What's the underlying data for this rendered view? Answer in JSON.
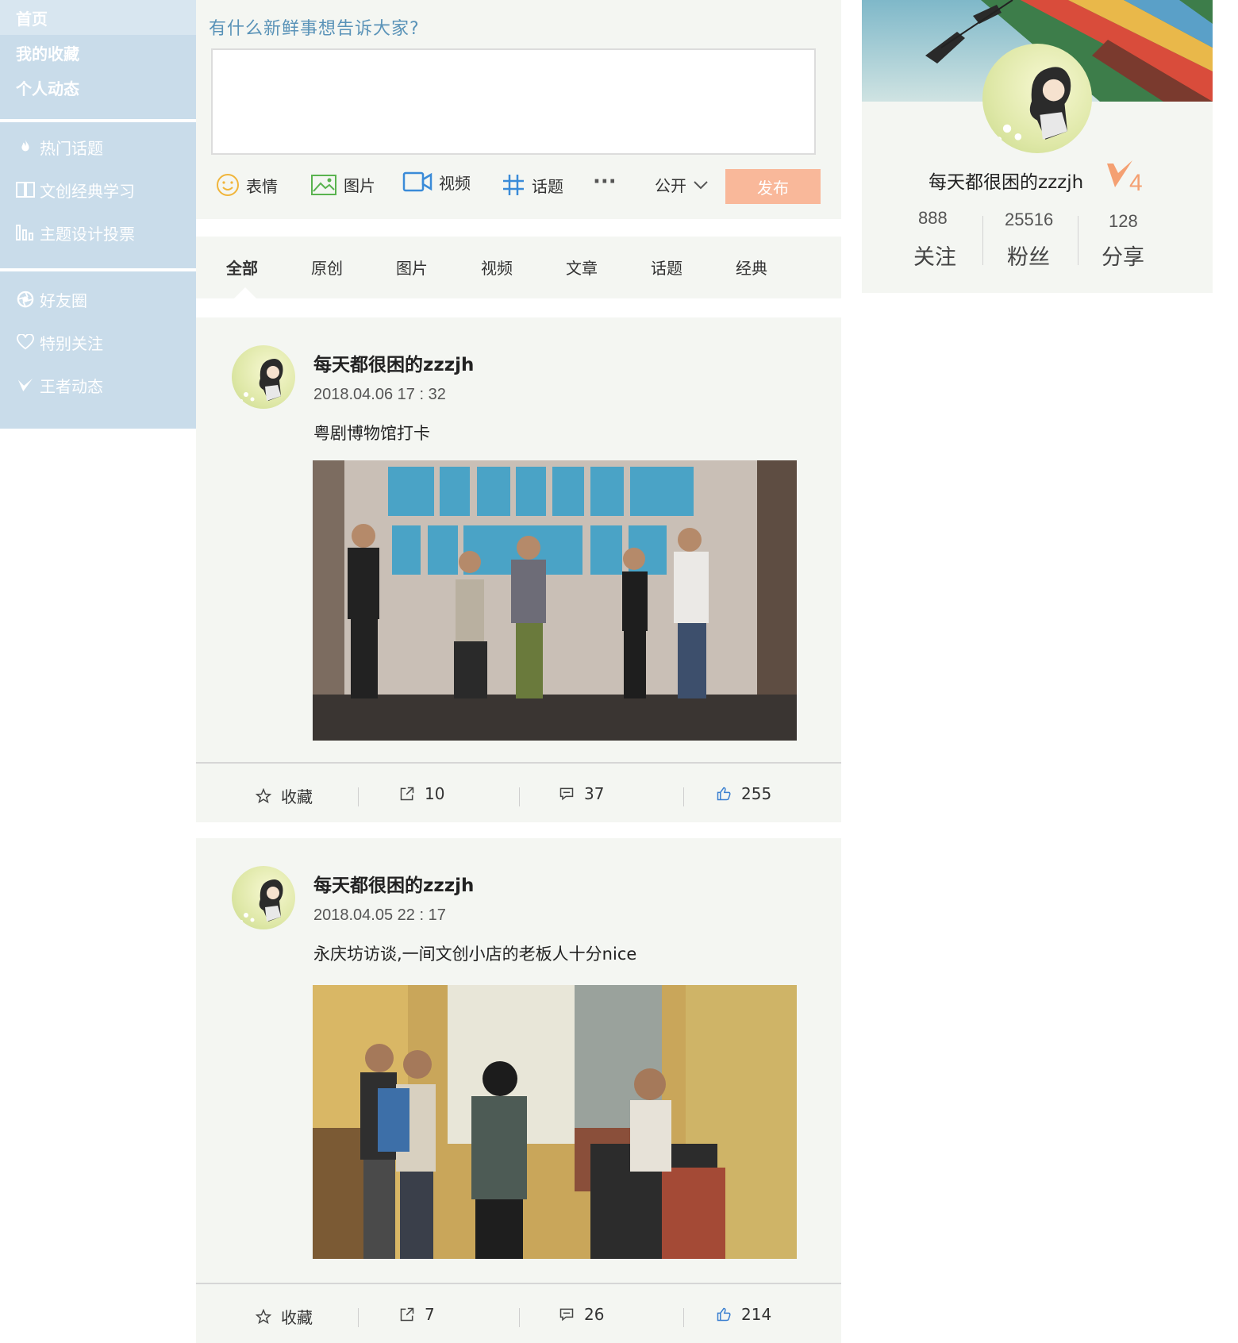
{
  "sidebar": {
    "group1": [
      {
        "label": "首页",
        "icon": ""
      },
      {
        "label": "我的收藏",
        "icon": ""
      },
      {
        "label": "个人动态",
        "icon": ""
      }
    ],
    "group2": [
      {
        "label": "热门话题",
        "icon": "fire-icon"
      },
      {
        "label": "文创经典学习",
        "icon": "book-icon"
      },
      {
        "label": "主题设计投票",
        "icon": "bar-chart-icon"
      }
    ],
    "group3": [
      {
        "label": "好友圈",
        "icon": "camera-aperture-icon"
      },
      {
        "label": "特别关注",
        "icon": "heart-icon"
      },
      {
        "label": "王者动态",
        "icon": "v-badge-icon"
      }
    ]
  },
  "composer": {
    "prompt": "有什么新鲜事想告诉大家?",
    "tools": {
      "emoji": "表情",
      "image": "图片",
      "video": "视频",
      "topic": "话题",
      "more": "···"
    },
    "visibility": "公开",
    "publish": "发布"
  },
  "tabs": [
    "全部",
    "原创",
    "图片",
    "视频",
    "文章",
    "话题",
    "经典"
  ],
  "posts": [
    {
      "author": "每天都很困的zzzjh",
      "time": "2018.04.06 17 : 32",
      "text": "粤剧博物馆打卡",
      "favorite_label": "收藏",
      "shares": "10",
      "comments": "37",
      "likes": "255"
    },
    {
      "author": "每天都很困的zzzjh",
      "time": "2018.04.05 22 : 17",
      "text": "永庆坊访谈,一间文创小店的老板人十分nice",
      "favorite_label": "收藏",
      "shares": "7",
      "comments": "26",
      "likes": "214"
    }
  ],
  "profile": {
    "name": "每天都很困的zzzjh",
    "level": "4",
    "stats": [
      {
        "value": "888",
        "label": "关注"
      },
      {
        "value": "25516",
        "label": "粉丝"
      },
      {
        "value": "128",
        "label": "分享"
      }
    ]
  },
  "colors": {
    "sidebar": "#c9dcea",
    "panel": "#f4f6f2",
    "accent_blue": "#5a93b8",
    "publish": "#f9b89a",
    "level_orange": "#f4a072"
  }
}
